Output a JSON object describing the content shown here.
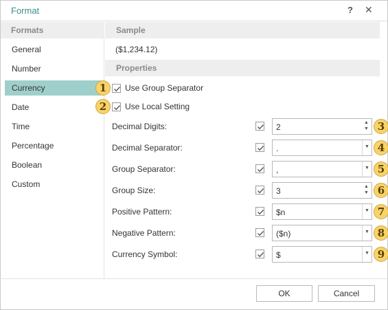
{
  "dialog": {
    "title": "Format",
    "help_label": "?",
    "close_label": "✕"
  },
  "sidebar": {
    "header": "Formats",
    "items": [
      {
        "label": "General"
      },
      {
        "label": "Number"
      },
      {
        "label": "Currency",
        "selected": true
      },
      {
        "label": "Date"
      },
      {
        "label": "Time"
      },
      {
        "label": "Percentage"
      },
      {
        "label": "Boolean"
      },
      {
        "label": "Custom"
      }
    ]
  },
  "sample": {
    "header": "Sample",
    "value": "($1,234.12)"
  },
  "properties": {
    "header": "Properties",
    "use_group_separator": {
      "label": "Use Group Separator",
      "checked": true,
      "badge": "1"
    },
    "use_local_setting": {
      "label": "Use Local Setting",
      "checked": true,
      "badge": "2"
    },
    "rows": [
      {
        "label": "Decimal Digits:",
        "value": "2",
        "control": "spinner",
        "checked": true,
        "badge": "3"
      },
      {
        "label": "Decimal Separator:",
        "value": ".",
        "control": "dropdown",
        "checked": true,
        "badge": "4"
      },
      {
        "label": "Group Separator:",
        "value": ",",
        "control": "dropdown",
        "checked": true,
        "badge": "5"
      },
      {
        "label": "Group Size:",
        "value": "3",
        "control": "spinner",
        "checked": true,
        "badge": "6"
      },
      {
        "label": "Positive Pattern:",
        "value": "$n",
        "control": "dropdown",
        "checked": true,
        "badge": "7"
      },
      {
        "label": "Negative Pattern:",
        "value": "($n)",
        "control": "dropdown",
        "checked": true,
        "badge": "8"
      },
      {
        "label": "Currency Symbol:",
        "value": "$",
        "control": "dropdown",
        "checked": true,
        "badge": "9"
      }
    ]
  },
  "footer": {
    "ok_label": "OK",
    "cancel_label": "Cancel"
  },
  "colors": {
    "accent": "#3a8f8a",
    "selected_bg": "#9fcfcb",
    "badge_bg": "#f7d36b",
    "header_bg": "#eeeeee"
  },
  "icons": {
    "help": "help-icon",
    "close": "close-icon",
    "checkmark": "checkmark-icon",
    "spin_up": "spin-up-icon",
    "spin_down": "spin-down-icon",
    "dropdown": "chevron-down-icon"
  }
}
